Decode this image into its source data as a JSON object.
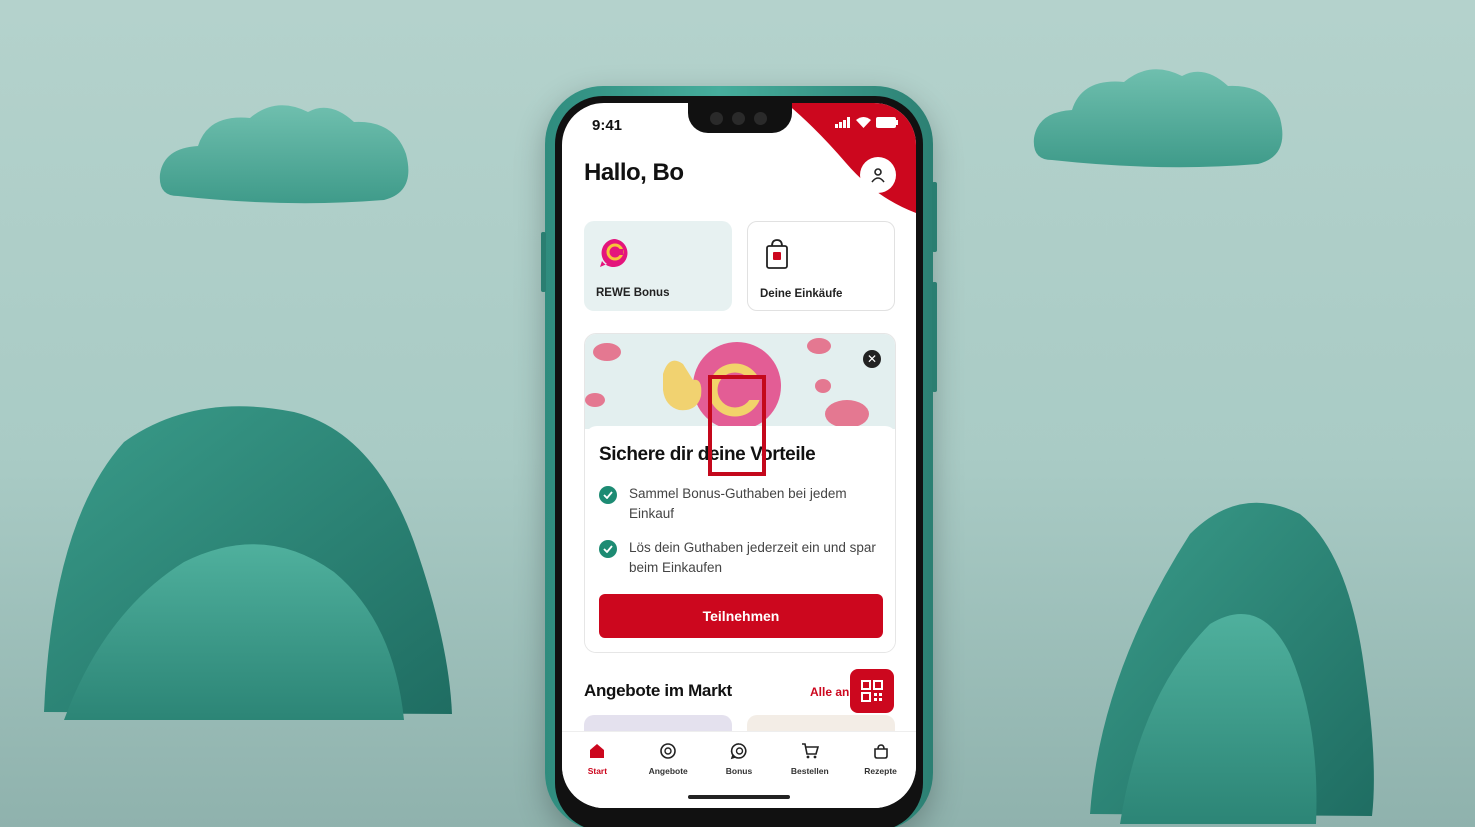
{
  "status_bar": {
    "time": "9:41"
  },
  "header": {
    "greeting": "Hallo, Bo"
  },
  "tiles": [
    {
      "label": "REWE Bonus",
      "icon": "rewe-bonus-icon"
    },
    {
      "label": "Deine Einkäufe",
      "icon": "shopping-bag-icon"
    }
  ],
  "promo": {
    "title": "Sichere dir deine Vorteile",
    "benefits": [
      "Sammel Bonus-Guthaben bei jedem Einkauf",
      "Lös dein Guthaben jederzeit ein und spar beim Einkaufen"
    ],
    "cta_label": "Teilnehmen",
    "close_icon": "close-icon"
  },
  "offers": {
    "title": "Angebote im Markt",
    "link_label": "Alle an"
  },
  "tabbar": {
    "items": [
      {
        "label": "Start",
        "icon": "home-icon",
        "active": true
      },
      {
        "label": "Angebote",
        "icon": "offers-icon",
        "active": false
      },
      {
        "label": "Bonus",
        "icon": "bonus-icon",
        "active": false
      },
      {
        "label": "Bestellen",
        "icon": "cart-icon",
        "active": false
      },
      {
        "label": "Rezepte",
        "icon": "recipe-pot-icon",
        "active": false
      }
    ]
  },
  "colors": {
    "brand_red": "#cc071e",
    "check_green": "#1d8b73",
    "background_mint": "#b4d2cc",
    "phone_teal": "#3da191"
  }
}
